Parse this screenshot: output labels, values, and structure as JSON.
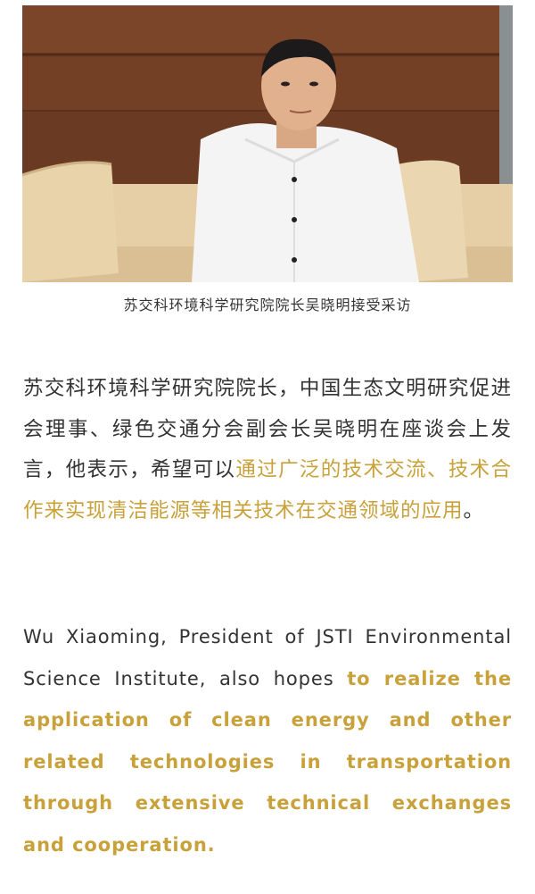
{
  "photo": {
    "description_icon": "interview-photo"
  },
  "caption": "苏交科环境科学研究院院长吴晓明接受采访",
  "cn_paragraph": {
    "normal": "苏交科环境科学研究院院长，中国生态文明研究促进会理事、绿色交通分会副会长吴晓明在座谈会上发言，他表示，希望可以",
    "highlight": "通过广泛的技术交流、技术合作来实现清洁能源等相关技术在交通领域的应用",
    "end": "。"
  },
  "en_paragraph": {
    "normal": "Wu Xiaoming, President of JSTI Environmental Science Institute, also hopes ",
    "highlight": "to realize the application of clean energy and other related technologies in transportation through extensive technical exchanges and cooperation."
  },
  "colors": {
    "highlight": "#c9a13a",
    "text": "#333333"
  }
}
